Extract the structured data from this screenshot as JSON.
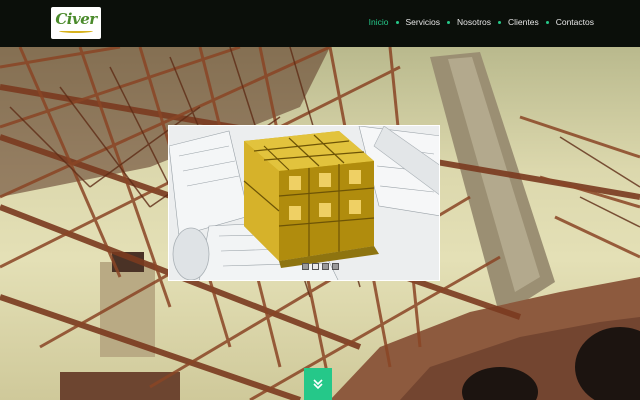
{
  "brand": {
    "logo_text": "Civer"
  },
  "nav": {
    "items": [
      {
        "label": "Inicio",
        "active": true
      },
      {
        "label": "Servicios",
        "active": false
      },
      {
        "label": "Nosotros",
        "active": false
      },
      {
        "label": "Clientes",
        "active": false
      },
      {
        "label": "Contactos",
        "active": false
      }
    ]
  },
  "slider": {
    "slide_count": 4,
    "active_index": 1
  },
  "icons": {
    "scroll_down": "chevron-double-down-icon",
    "nav_separator": "dot-icon"
  },
  "colors": {
    "accent": "#25c889",
    "header_bg": "#0b0f0a",
    "nav_text": "#e6e6e6"
  }
}
